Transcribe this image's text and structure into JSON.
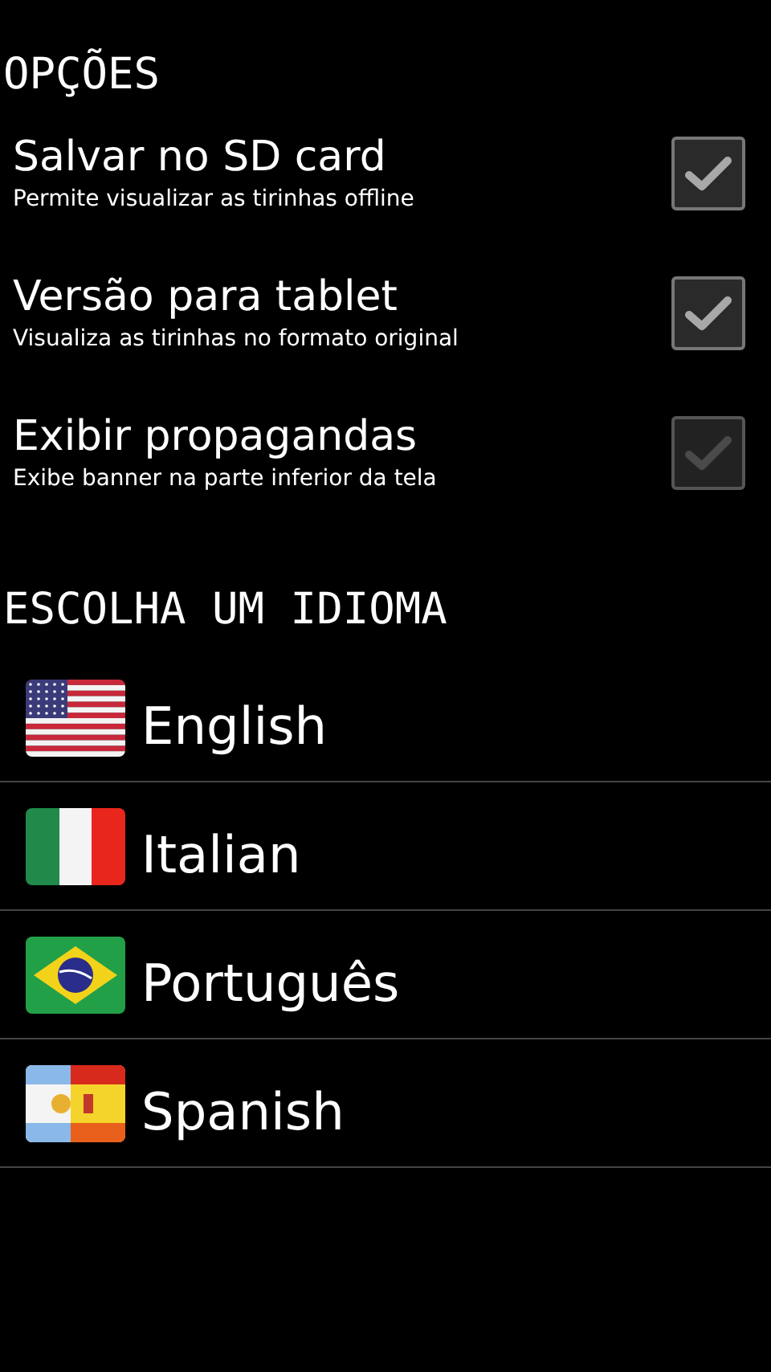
{
  "options_header": "OPÇÕES",
  "options": [
    {
      "title": "Salvar no SD card",
      "summary": "Permite visualizar as tirinhas offline",
      "checked": true,
      "disabled": false
    },
    {
      "title": "Versão para tablet",
      "summary": "Visualiza as tirinhas no formato original",
      "checked": true,
      "disabled": false
    },
    {
      "title": "Exibir propagandas",
      "summary": "Exibe banner na parte inferior da tela",
      "checked": true,
      "disabled": true
    }
  ],
  "language_header": "ESCOLHA UM IDIOMA",
  "languages": [
    {
      "label": "English",
      "kind": "us"
    },
    {
      "label": "Italian",
      "kind": "it"
    },
    {
      "label": "Português",
      "kind": "br"
    },
    {
      "label": "Spanish",
      "kind": "ares"
    }
  ]
}
